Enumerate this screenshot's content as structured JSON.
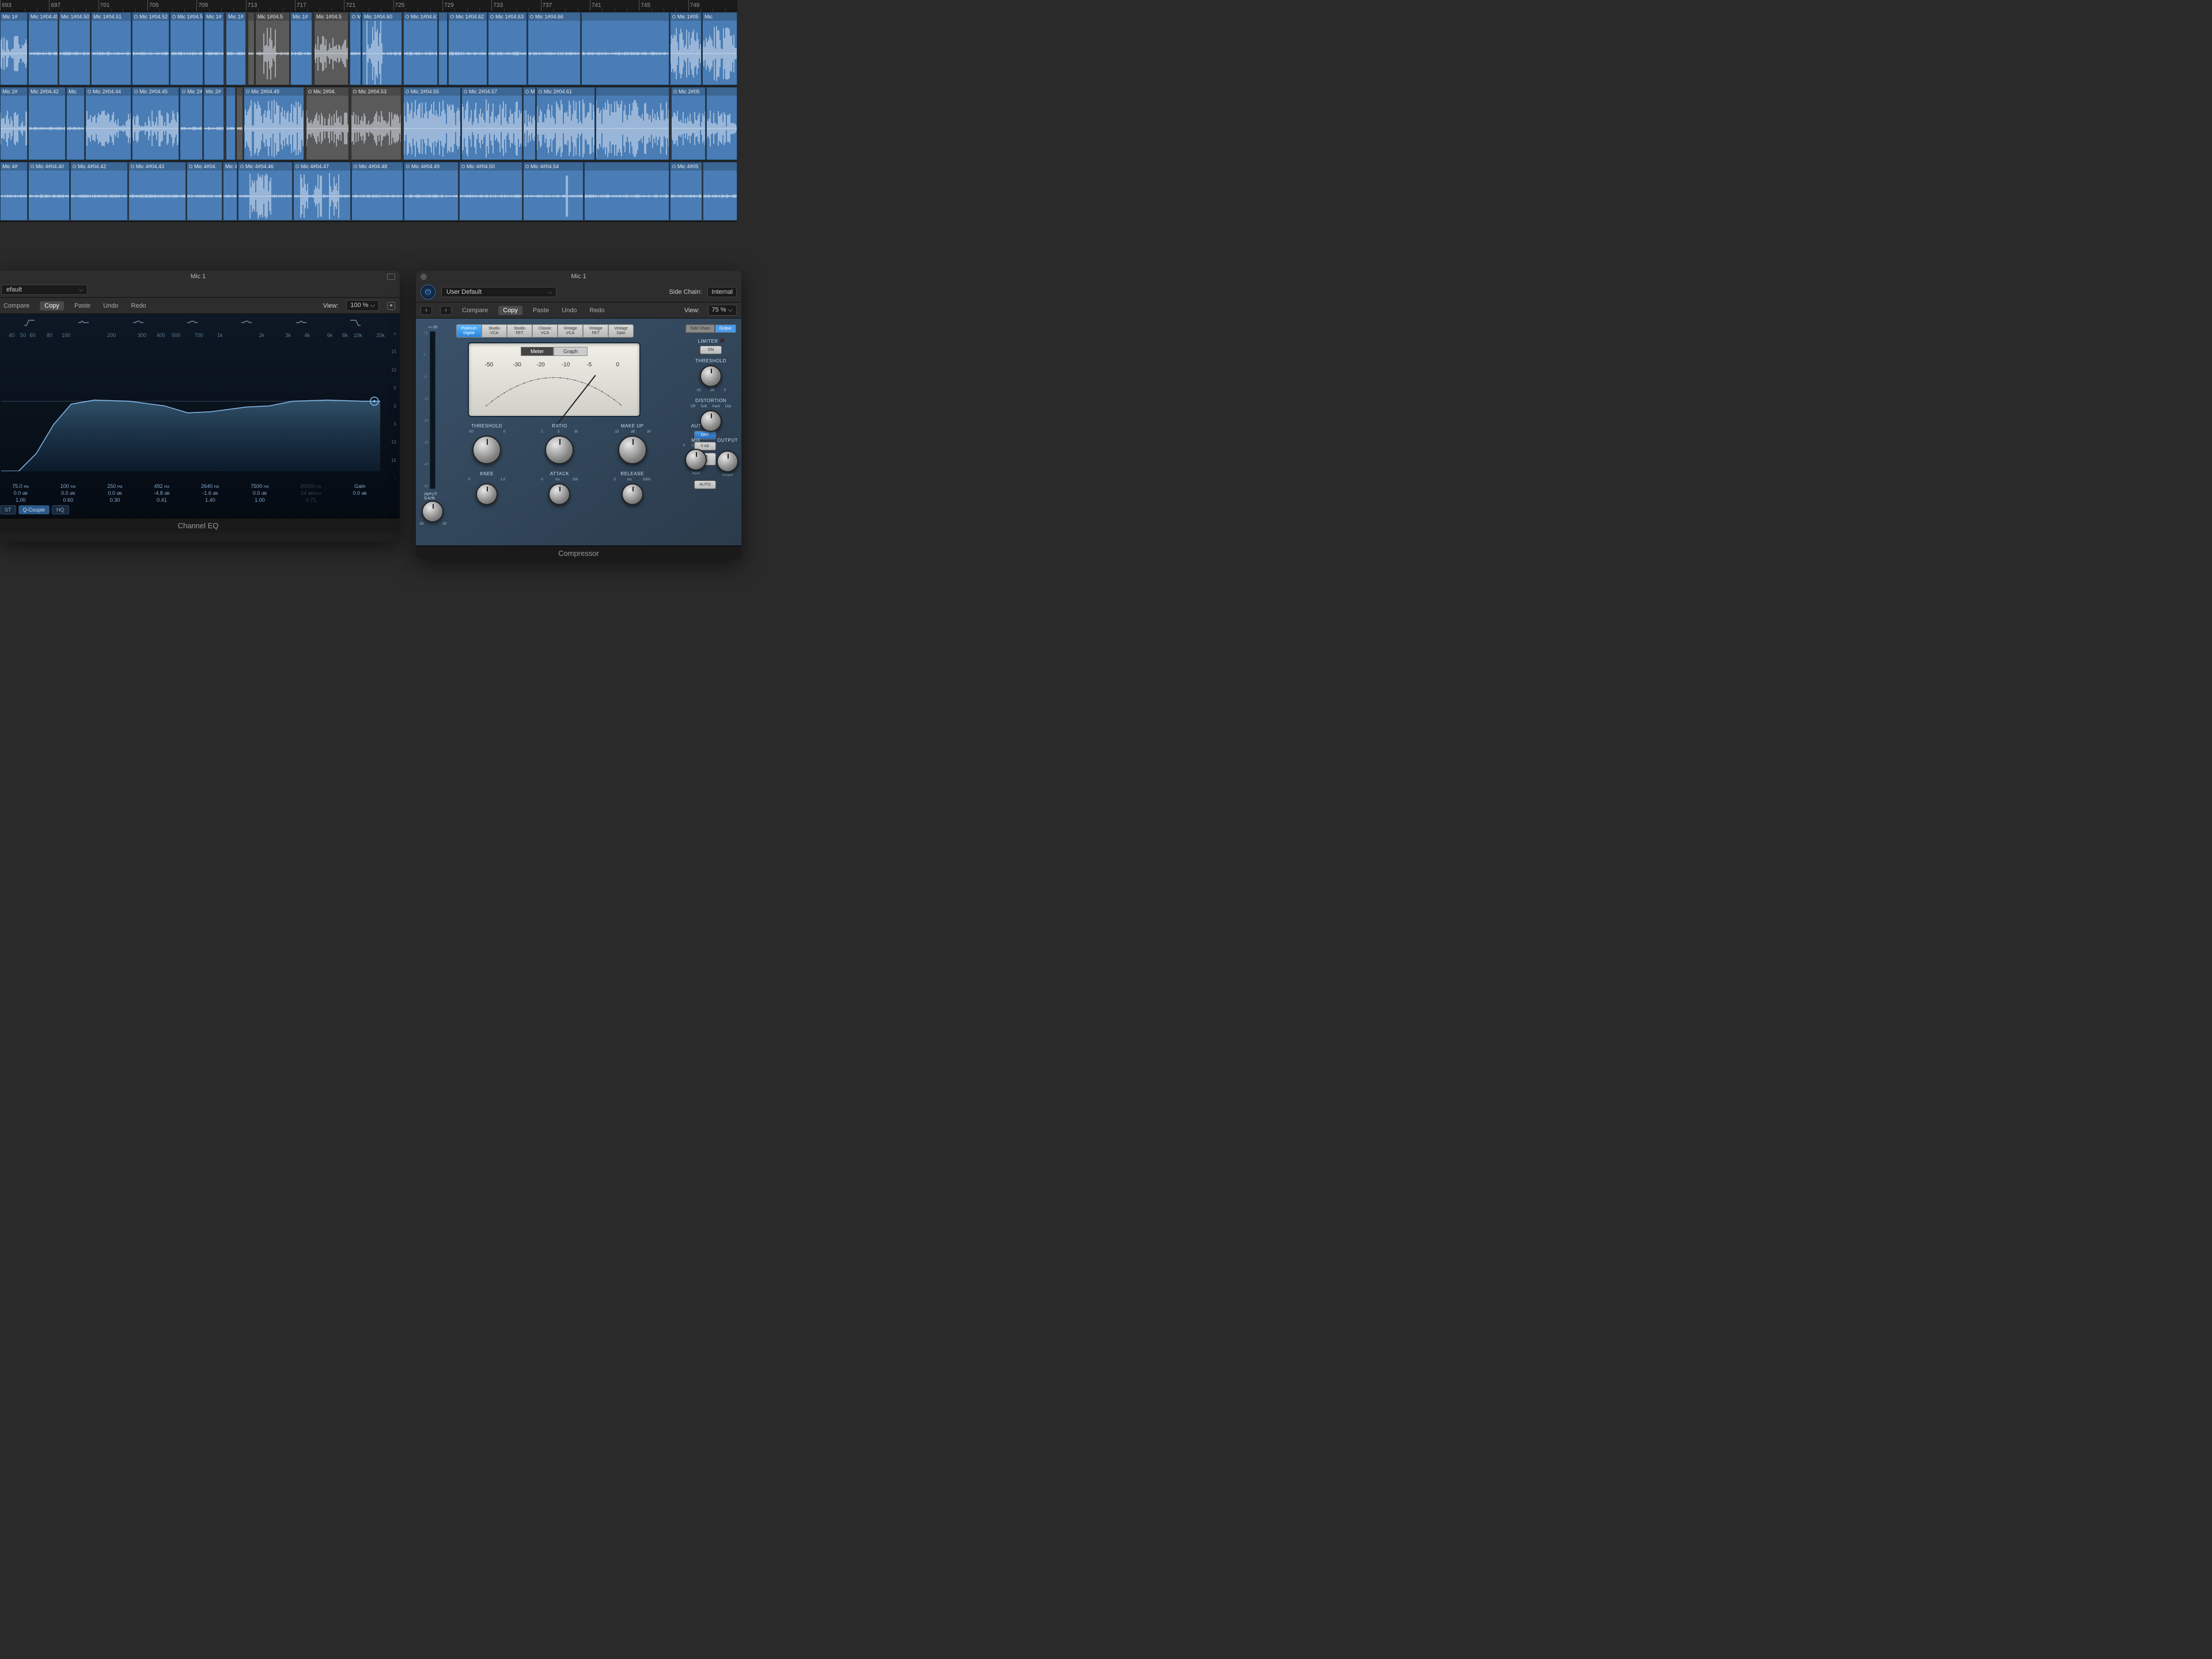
{
  "ruler": {
    "start": 693,
    "ticks": [
      693,
      697,
      701,
      705,
      709,
      713,
      717,
      721,
      725,
      729,
      733,
      737,
      741,
      745,
      749
    ]
  },
  "tracks": [
    {
      "name": "Mic 1",
      "regions": [
        {
          "l": 0,
          "w": 48,
          "label": "Mic 1#",
          "wave": "med"
        },
        {
          "l": 49,
          "w": 52,
          "label": "Mic 1#04.49",
          "wave": "low"
        },
        {
          "l": 102,
          "w": 55,
          "label": "Mic 1#04.50",
          "wave": "low"
        },
        {
          "l": 158,
          "w": 70,
          "label": "Mic 1#04.51",
          "wave": "low"
        },
        {
          "l": 229,
          "w": 65,
          "label": "Mic 1#04.52",
          "loop": true,
          "wave": "low"
        },
        {
          "l": 295,
          "w": 58,
          "label": "Mic 1#04.53",
          "loop": true,
          "wave": "low"
        },
        {
          "l": 354,
          "w": 35,
          "label": "Mic 1#",
          "wave": "low"
        },
        {
          "l": 392,
          "w": 35,
          "label": "Mic 1#",
          "wave": "low"
        },
        {
          "l": 430,
          "w": 12,
          "label": "",
          "muted": true,
          "wave": "low"
        },
        {
          "l": 443,
          "w": 60,
          "label": "Mic 1#04.5",
          "muted": true,
          "wave": "burst"
        },
        {
          "l": 504,
          "w": 38,
          "label": "Mic 1#",
          "wave": "low"
        },
        {
          "l": 545,
          "w": 60,
          "label": "Mic 1#04.5",
          "muted": true,
          "wave": "med"
        },
        {
          "l": 607,
          "w": 20,
          "label": "M",
          "loop": true,
          "wave": "low"
        },
        {
          "l": 628,
          "w": 70,
          "label": "Mic 1#04.60",
          "wave": "burst2"
        },
        {
          "l": 700,
          "w": 60,
          "label": "Mic 1#04.61",
          "loop": true,
          "wave": "low"
        },
        {
          "l": 761,
          "w": 16,
          "label": "",
          "wave": "low"
        },
        {
          "l": 778,
          "w": 68,
          "label": "Mic 1#04.62",
          "loop": true,
          "wave": "low"
        },
        {
          "l": 847,
          "w": 68,
          "label": "Mic 1#04.63",
          "loop": true,
          "wave": "low"
        },
        {
          "l": 916,
          "w": 92,
          "label": "Mic 1#04.66",
          "loop": true,
          "wave": "low"
        },
        {
          "l": 1009,
          "w": 153,
          "label": "",
          "wave": "low"
        },
        {
          "l": 1163,
          "w": 55,
          "label": "Mic 1#05",
          "loop": true,
          "wave": "high"
        },
        {
          "l": 1219,
          "w": 61,
          "label": "Mic",
          "wave": "high"
        }
      ]
    },
    {
      "name": "Mic 2",
      "regions": [
        {
          "l": 0,
          "w": 48,
          "label": "Mic 2#",
          "wave": "med"
        },
        {
          "l": 49,
          "w": 65,
          "label": "Mic 2#04.42",
          "wave": "low"
        },
        {
          "l": 115,
          "w": 32,
          "label": "Mic",
          "wave": "low"
        },
        {
          "l": 148,
          "w": 80,
          "label": "Mic 2#04.44",
          "loop": true,
          "wave": "med"
        },
        {
          "l": 229,
          "w": 82,
          "label": "Mic 2#04.45",
          "loop": true,
          "wave": "med"
        },
        {
          "l": 312,
          "w": 40,
          "label": "Mic 2#",
          "loop": true,
          "wave": "low"
        },
        {
          "l": 353,
          "w": 36,
          "label": "Mic 2#",
          "wave": "low"
        },
        {
          "l": 392,
          "w": 17,
          "label": "",
          "wave": "low"
        },
        {
          "l": 410,
          "w": 12,
          "label": "",
          "muted": true,
          "wave": "low"
        },
        {
          "l": 423,
          "w": 105,
          "label": "Mic 2#04.49",
          "loop": true,
          "wave": "high"
        },
        {
          "l": 531,
          "w": 75,
          "label": "Mic 2#04.",
          "loop": true,
          "muted": true,
          "wave": "med"
        },
        {
          "l": 609,
          "w": 88,
          "label": "Mic 2#04.53",
          "loop": true,
          "muted": true,
          "wave": "med"
        },
        {
          "l": 700,
          "w": 100,
          "label": "Mic 2#04.55",
          "loop": true,
          "wave": "high"
        },
        {
          "l": 801,
          "w": 106,
          "label": "Mic 2#04.57",
          "loop": true,
          "wave": "high"
        },
        {
          "l": 908,
          "w": 22,
          "label": "M",
          "loop": true,
          "wave": "med"
        },
        {
          "l": 931,
          "w": 102,
          "label": "Mic 2#04.61",
          "loop": true,
          "wave": "high"
        },
        {
          "l": 1034,
          "w": 128,
          "label": "",
          "wave": "high"
        },
        {
          "l": 1165,
          "w": 60,
          "label": "Mic 2#05",
          "loop": true,
          "wave": "med"
        },
        {
          "l": 1226,
          "w": 54,
          "label": "",
          "wave": "med"
        }
      ]
    },
    {
      "name": "Mic 4",
      "short": true,
      "regions": [
        {
          "l": 0,
          "w": 48,
          "label": "Mic 4#",
          "wave": "low"
        },
        {
          "l": 49,
          "w": 72,
          "label": "Mic 4#04.40",
          "loop": true,
          "wave": "low"
        },
        {
          "l": 122,
          "w": 100,
          "label": "Mic 4#04.42",
          "loop": true,
          "wave": "low"
        },
        {
          "l": 223,
          "w": 100,
          "label": "Mic 4#04.43",
          "loop": true,
          "wave": "low"
        },
        {
          "l": 324,
          "w": 62,
          "label": "Mic 4#04.",
          "loop": true,
          "wave": "low"
        },
        {
          "l": 387,
          "w": 25,
          "label": "Mic 4#",
          "wave": "low"
        },
        {
          "l": 413,
          "w": 95,
          "label": "Mic 4#04.46",
          "loop": true,
          "wave": "burst"
        },
        {
          "l": 509,
          "w": 100,
          "label": "Mic 4#04.47",
          "loop": true,
          "wave": "burst3"
        },
        {
          "l": 610,
          "w": 90,
          "label": "Mic 4#04.48",
          "loop": true,
          "wave": "low"
        },
        {
          "l": 701,
          "w": 95,
          "label": "Mic 4#04.49",
          "loop": true,
          "wave": "low"
        },
        {
          "l": 797,
          "w": 110,
          "label": "Mic 4#04.50",
          "loop": true,
          "wave": "low"
        },
        {
          "l": 908,
          "w": 105,
          "label": "Mic 4#04.54",
          "loop": true,
          "wave": "spike"
        },
        {
          "l": 1014,
          "w": 148,
          "label": "",
          "wave": "low"
        },
        {
          "l": 1163,
          "w": 56,
          "label": "Mic 4#05",
          "loop": true,
          "wave": "low"
        },
        {
          "l": 1220,
          "w": 60,
          "label": "",
          "wave": "low"
        }
      ]
    }
  ],
  "eq": {
    "title": "Mic 1",
    "preset": "efault",
    "toolbar": {
      "compare": "Compare",
      "copy": "Copy",
      "paste": "Paste",
      "undo": "Undo",
      "redo": "Redo",
      "view": "View:",
      "zoom": "100 %"
    },
    "scale_right": [
      "+",
      "15",
      "10",
      "5",
      "0",
      "5",
      "10",
      "15",
      "-"
    ],
    "freq_labels": [
      {
        "t": "40",
        "p": 2
      },
      {
        "t": "50",
        "p": 5
      },
      {
        "t": "60",
        "p": 7.5
      },
      {
        "t": "80",
        "p": 12
      },
      {
        "t": "100",
        "p": 16
      },
      {
        "t": "200",
        "p": 28
      },
      {
        "t": "300",
        "p": 36
      },
      {
        "t": "400",
        "p": 41
      },
      {
        "t": "500",
        "p": 45
      },
      {
        "t": "700",
        "p": 51
      },
      {
        "t": "1k",
        "p": 57
      },
      {
        "t": "2k",
        "p": 68
      },
      {
        "t": "3k",
        "p": 75
      },
      {
        "t": "4k",
        "p": 80
      },
      {
        "t": "6k",
        "p": 86
      },
      {
        "t": "8k",
        "p": 90
      },
      {
        "t": "10k",
        "p": 93
      },
      {
        "t": "20k",
        "p": 99
      }
    ],
    "bands": [
      {
        "freq": "75.0",
        "funit": "Hz",
        "gain": "0.0",
        "gunit": "dB",
        "q": "1.00"
      },
      {
        "freq": "100",
        "funit": "Hz",
        "gain": "0.0",
        "gunit": "dB",
        "q": "0.60"
      },
      {
        "freq": "250",
        "funit": "Hz",
        "gain": "0.0",
        "gunit": "dB",
        "q": "0.30"
      },
      {
        "freq": "492",
        "funit": "Hz",
        "gain": "-4.8",
        "gunit": "dB",
        "q": "0.41"
      },
      {
        "freq": "2640",
        "funit": "Hz",
        "gain": "-1.6",
        "gunit": "dB",
        "q": "1.40"
      },
      {
        "freq": "7500",
        "funit": "Hz",
        "gain": "0.0",
        "gunit": "dB",
        "q": "1.00"
      },
      {
        "freq": "20000",
        "funit": "Hz",
        "gain": "24",
        "gunit": "dB/Oct",
        "q": "0.71",
        "dim": true
      }
    ],
    "gain_label": "Gain",
    "gain_val": "0.0",
    "gain_unit": "dB",
    "buttons": {
      "st": "ST",
      "qcouple": "Q-Couple",
      "hq": "HQ"
    },
    "footer": "Channel EQ"
  },
  "comp": {
    "title": "Mic 1",
    "preset": "User Default",
    "sidechain_label": "Side Chain:",
    "sidechain_val": "Internal",
    "toolbar": {
      "compare": "Compare",
      "copy": "Copy",
      "paste": "Paste",
      "undo": "Undo",
      "redo": "Redo",
      "view": "View:",
      "zoom": "75 %"
    },
    "types": [
      "Platinum Digital",
      "Studio VCA",
      "Studio FET",
      "Classic VCA",
      "Vintage VCA",
      "Vintage FET",
      "Vintage Opto"
    ],
    "vu": {
      "meter": "Meter",
      "graph": "Graph",
      "scale": [
        {
          "t": "-50",
          "p": 3
        },
        {
          "t": "-30",
          "p": 22
        },
        {
          "t": "-20",
          "p": 38
        },
        {
          "t": "-10",
          "p": 55
        },
        {
          "t": "-5",
          "p": 72
        },
        {
          "t": "0",
          "p": 92
        }
      ]
    },
    "input_meter": {
      "label": "-∞ dB",
      "scale": [
        "+3",
        "0",
        "-5",
        "-10",
        "-20",
        "-30",
        "-40",
        "-60"
      ],
      "gain": "INPUT GAIN",
      "ticks": {
        "l": "-30",
        "r": "30"
      }
    },
    "knobs_row1": [
      {
        "label": "THRESHOLD",
        "ticks": {
          "l": "-50",
          "r": "0"
        }
      },
      {
        "label": "RATIO",
        "ticks": {
          "l": "1",
          "m": "5",
          "r": "30"
        }
      },
      {
        "label": "MAKE UP",
        "ticks": {
          "l": "-10",
          "m": "dB",
          "r": "30"
        }
      }
    ],
    "auto_gain": {
      "label": "AUTO GAIN",
      "off": "OFF",
      "zero": "0 dB",
      "neg": "-12 dB"
    },
    "knobs_row2": [
      {
        "label": "KNEE",
        "ticks": {
          "l": "0",
          "r": "1.0"
        }
      },
      {
        "label": "ATTACK",
        "ticks": {
          "l": "0",
          "m": "ms",
          "r": "200"
        }
      },
      {
        "label": "RELEASE",
        "ticks": {
          "l": "5",
          "m": "ms",
          "r": "5000"
        }
      }
    ],
    "auto_release": {
      "auto": "AUTO"
    },
    "side": {
      "sidechain": "Side Chain",
      "output": "Output",
      "limiter": "LIMITER",
      "on": "ON",
      "threshold": "THRESHOLD",
      "thresh_ticks": {
        "l": "-30",
        "m": "dB",
        "r": "0"
      },
      "distortion": "DISTORTION",
      "dist_labels": [
        "Off",
        "Soft",
        "Hard",
        "Clip"
      ],
      "mix": "MIX",
      "mix_ticks": {
        "l": "0",
        "m": "1:1",
        "r": "100"
      },
      "output_gain": "OUTPUT",
      "out_labels": {
        "l": "Input",
        "r": "Output"
      }
    },
    "footer": "Compressor"
  }
}
